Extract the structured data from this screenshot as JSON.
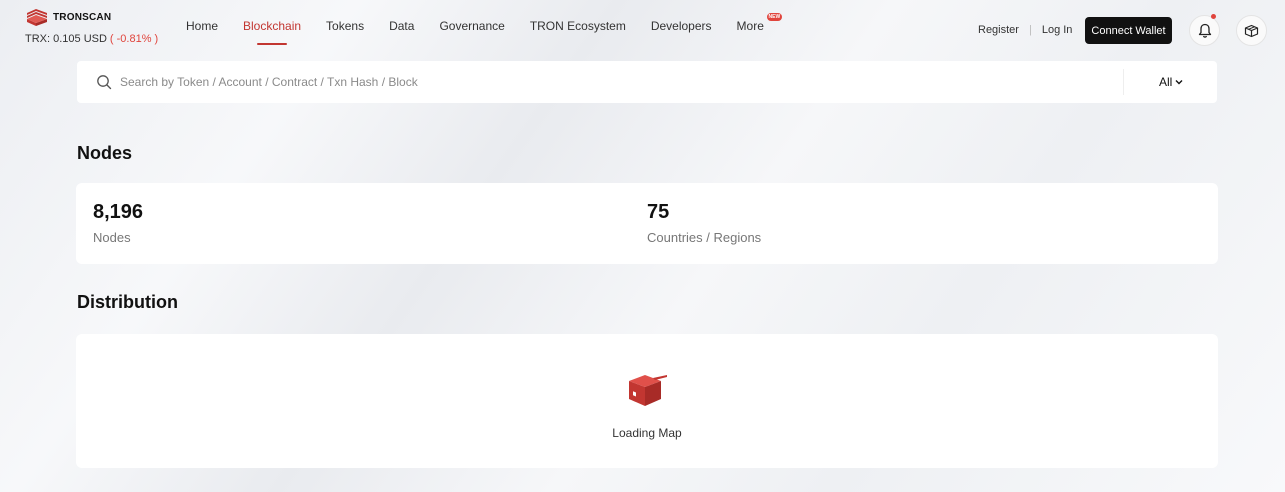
{
  "header": {
    "logo_text": "TRONSCAN",
    "price_label": "TRX: 0.105 USD",
    "price_change": "( -0.81% )",
    "nav": [
      {
        "label": "Home"
      },
      {
        "label": "Blockchain"
      },
      {
        "label": "Tokens"
      },
      {
        "label": "Data"
      },
      {
        "label": "Governance"
      },
      {
        "label": "TRON Ecosystem"
      },
      {
        "label": "Developers"
      },
      {
        "label": "More"
      }
    ],
    "more_badge": "NEW",
    "register": "Register",
    "separator": "|",
    "login": "Log In",
    "connect_wallet": "Connect Wallet"
  },
  "search": {
    "placeholder": "Search by Token / Account / Contract / Txn Hash / Block",
    "filter": "All"
  },
  "nodes": {
    "title": "Nodes",
    "count_value": "8,196",
    "count_label": "Nodes",
    "countries_value": "75",
    "countries_label": "Countries / Regions"
  },
  "distribution": {
    "title": "Distribution",
    "loading": "Loading Map"
  },
  "colors": {
    "brand_red": "#c23631",
    "negative": "#e0443c",
    "button_dark": "#111111"
  }
}
